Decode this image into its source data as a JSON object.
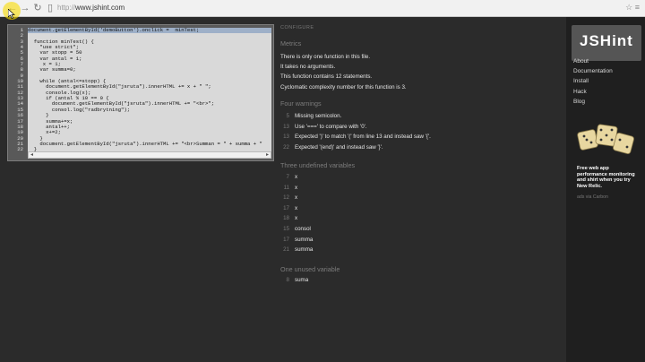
{
  "browser": {
    "url_scheme": "http://",
    "url_host": "www.jshint.com"
  },
  "editor": {
    "line_numbers": [
      "1",
      "2",
      "3",
      "4",
      "5",
      "6",
      "7",
      "8",
      "9",
      "10",
      "11",
      "12",
      "13",
      "14",
      "15",
      "16",
      "17",
      "18",
      "19",
      "20",
      "21",
      "22"
    ],
    "lines": [
      "document.getElementById('demoButton').onclick =  minTest;",
      "",
      "  function minTest() {",
      "    \"use strict\";",
      "    var stopp = 50",
      "    var antal = 1;",
      "     x = 1;",
      "    var summa=0;",
      "",
      "    while (antal<=stopp) {",
      "      document.getElementById(\"jsruta\").innerHTML += x + \" \";",
      "      console.log(x);",
      "      if (antal % 10 == 0 {",
      "        document.getElementById(\"jsruta\").innerHTML += \"<br>\";",
      "        consol.log(\"radbrytning\");",
      "      }",
      "      summa+=x;",
      "      antal++;",
      "      x+=2;",
      "    }",
      "    document.getElementById(\"jsruta\").innerHTML += \"<br>Summan = \" + summa + \"",
      "  }"
    ]
  },
  "report": {
    "caption": "CONFIGURE",
    "metrics_heading": "Metrics",
    "metrics": [
      "There is only one function in this file.",
      "It takes no arguments.",
      "This function contains 12 statements.",
      "Cyclomatic complexity number for this function is 3."
    ],
    "warnings_heading": "Four warnings",
    "warnings": [
      {
        "line": "5",
        "msg": "Missing semicolon."
      },
      {
        "line": "13",
        "msg": "Use '===' to compare with '0'."
      },
      {
        "line": "13",
        "msg": "Expected ')' to match '(' from line 13 and instead saw '{'."
      },
      {
        "line": "22",
        "msg": "Expected '(end)' and instead saw '}'."
      }
    ],
    "undefined_heading": "Three undefined variables",
    "undefined": [
      {
        "line": "7",
        "name": "x"
      },
      {
        "line": "11",
        "name": "x"
      },
      {
        "line": "12",
        "name": "x"
      },
      {
        "line": "17",
        "name": "x"
      },
      {
        "line": "18",
        "name": "x"
      },
      {
        "line": "15",
        "name": "consol"
      },
      {
        "line": "17",
        "name": "summa"
      },
      {
        "line": "21",
        "name": "summa"
      }
    ],
    "unused_heading": "One unused variable",
    "unused": [
      {
        "line": "8",
        "name": "suma"
      }
    ]
  },
  "sidebar": {
    "logo": "JSHint",
    "links": [
      "About",
      "Documentation",
      "Install",
      "Hack",
      "Blog"
    ],
    "ad_text": "Free web app performance monitoring and shirt when you try New Relic.",
    "ad_sub": "ads via Carbon"
  }
}
